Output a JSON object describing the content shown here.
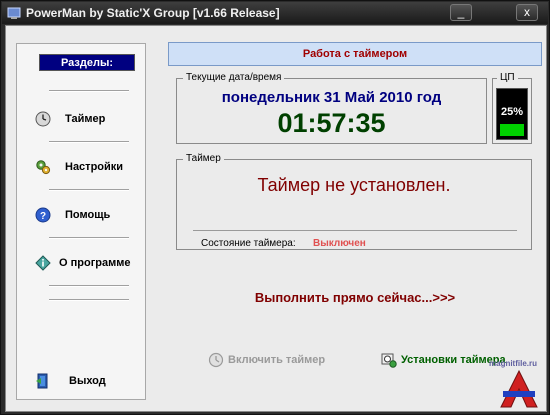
{
  "window": {
    "title": "PowerMan by Static'X Group [v1.66 Release]",
    "minimize_glyph": "_",
    "close_glyph": "x"
  },
  "sidebar": {
    "title": "Разделы:",
    "items": [
      {
        "label": "Таймер",
        "icon": "clock-icon"
      },
      {
        "label": "Настройки",
        "icon": "gears-icon"
      },
      {
        "label": "Помощь",
        "icon": "help-icon"
      },
      {
        "label": "О программе",
        "icon": "info-diamond-icon"
      },
      {
        "label": "Выход",
        "icon": "exit-door-icon"
      }
    ]
  },
  "main": {
    "header": "Работа с таймером",
    "datetime": {
      "label": "Текущие дата/время",
      "date": "понедельник 31 Май 2010 год",
      "time": "01:57:35"
    },
    "cpu": {
      "label": "ЦП",
      "value_text": "25%",
      "fraction": 0.25,
      "bar_color": "#00d000"
    },
    "timer": {
      "label": "Таймер",
      "status_text": "Таймер не установлен.",
      "state_label": "Состояние таймера:",
      "state_value": "Выключен",
      "state_color": "#e05050"
    },
    "run_now": "Выполнить прямо сейчас...>>>",
    "enable_button": "Включить таймер",
    "settings_button": "Установки таймера"
  },
  "watermark": {
    "text": "magnitfile.ru",
    "letter": "A"
  },
  "colors": {
    "header_bg": "#cfe0f7",
    "header_text": "#a00000",
    "sidebar_title_bg": "#000080",
    "date_text": "#000080",
    "time_text": "#004000"
  }
}
